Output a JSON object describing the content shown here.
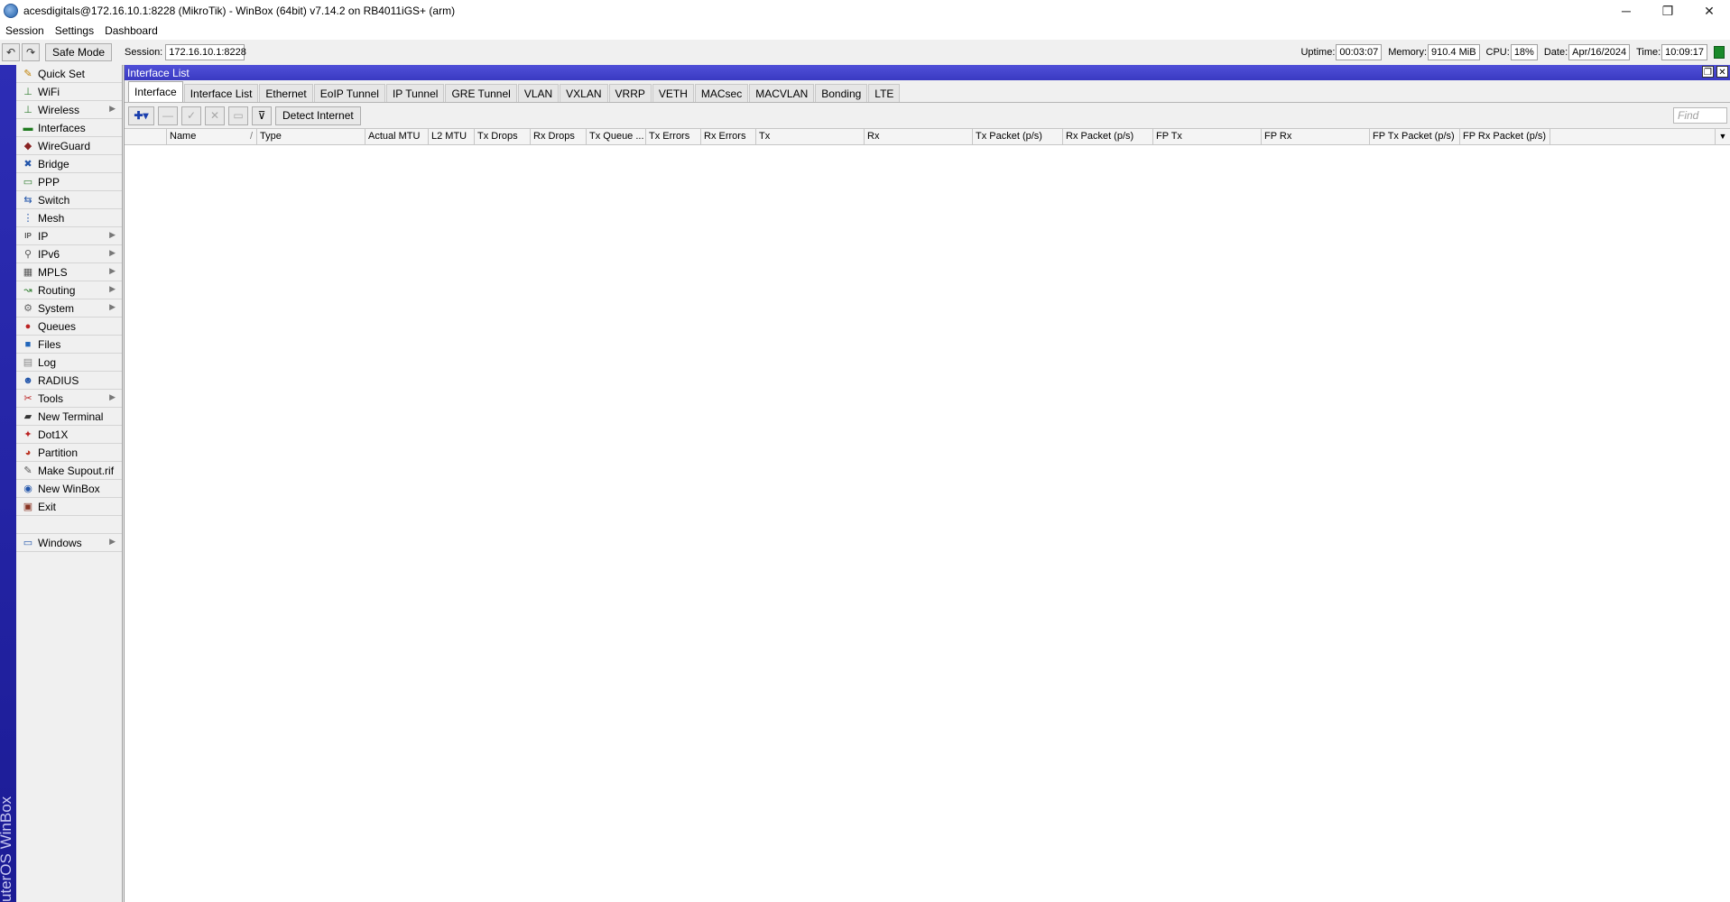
{
  "window": {
    "title": "acesdigitals@172.16.10.1:8228 (MikroTik) - WinBox (64bit) v7.14.2 on RB4011iGS+ (arm)",
    "controls": {
      "minimize": "─",
      "maximize": "❐",
      "close": "✕"
    }
  },
  "menu": [
    "Session",
    "Settings",
    "Dashboard"
  ],
  "toolbar": {
    "undo_icon": "↶",
    "redo_icon": "↷",
    "safe_mode": "Safe Mode",
    "session_label": "Session:",
    "session_value": "172.16.10.1:8228",
    "uptime_label": "Uptime:",
    "uptime_value": "00:03:07",
    "memory_label": "Memory:",
    "memory_value": "910.4 MiB",
    "cpu_label": "CPU:",
    "cpu_value": "18%",
    "date_label": "Date:",
    "date_value": "Apr/16/2024",
    "time_label": "Time:",
    "time_value": "10:09:17"
  },
  "side_strip_text": "uterOS WinBox",
  "sidebar": {
    "items": [
      {
        "label": "Quick Set",
        "icon": "✎",
        "color": "#c08000",
        "arrow": false
      },
      {
        "label": "WiFi",
        "icon": "⊥",
        "color": "#2a7a2a",
        "arrow": false
      },
      {
        "label": "Wireless",
        "icon": "⊥",
        "color": "#2a7a2a",
        "arrow": true
      },
      {
        "label": "Interfaces",
        "icon": "▬",
        "color": "#1f7a1f",
        "arrow": false
      },
      {
        "label": "WireGuard",
        "icon": "◆",
        "color": "#882222",
        "arrow": false
      },
      {
        "label": "Bridge",
        "icon": "✖",
        "color": "#2255aa",
        "arrow": false
      },
      {
        "label": "PPP",
        "icon": "▭",
        "color": "#2a7a2a",
        "arrow": false
      },
      {
        "label": "Switch",
        "icon": "⇆",
        "color": "#2255aa",
        "arrow": false
      },
      {
        "label": "Mesh",
        "icon": "⋮",
        "color": "#2255aa",
        "arrow": false
      },
      {
        "label": "IP",
        "icon": "IP",
        "color": "#555555",
        "arrow": true
      },
      {
        "label": "IPv6",
        "icon": "⚲",
        "color": "#555555",
        "arrow": true
      },
      {
        "label": "MPLS",
        "icon": "▦",
        "color": "#555555",
        "arrow": true
      },
      {
        "label": "Routing",
        "icon": "↝",
        "color": "#2a7a2a",
        "arrow": true
      },
      {
        "label": "System",
        "icon": "⚙",
        "color": "#666666",
        "arrow": true
      },
      {
        "label": "Queues",
        "icon": "●",
        "color": "#bb2222",
        "arrow": false
      },
      {
        "label": "Files",
        "icon": "■",
        "color": "#2266bb",
        "arrow": false
      },
      {
        "label": "Log",
        "icon": "▤",
        "color": "#888888",
        "arrow": false
      },
      {
        "label": "RADIUS",
        "icon": "☻",
        "color": "#2255aa",
        "arrow": false
      },
      {
        "label": "Tools",
        "icon": "✂",
        "color": "#bb2222",
        "arrow": true
      },
      {
        "label": "New Terminal",
        "icon": "▰",
        "color": "#333333",
        "arrow": false
      },
      {
        "label": "Dot1X",
        "icon": "✦",
        "color": "#bb2222",
        "arrow": false
      },
      {
        "label": "Partition",
        "icon": "◕",
        "color": "#bb3322",
        "arrow": false
      },
      {
        "label": "Make Supout.rif",
        "icon": "✎",
        "color": "#555555",
        "arrow": false
      },
      {
        "label": "New WinBox",
        "icon": "◉",
        "color": "#2255aa",
        "arrow": false
      },
      {
        "label": "Exit",
        "icon": "▣",
        "color": "#883322",
        "arrow": false
      }
    ],
    "windows": {
      "label": "Windows",
      "icon": "▭",
      "color": "#2255aa",
      "arrow": true
    }
  },
  "panel": {
    "title": "Interface List",
    "ctrl_restore": "❐",
    "ctrl_close": "✕",
    "tabs": [
      "Interface",
      "Interface List",
      "Ethernet",
      "EoIP Tunnel",
      "IP Tunnel",
      "GRE Tunnel",
      "VLAN",
      "VXLAN",
      "VRRP",
      "VETH",
      "MACsec",
      "MACVLAN",
      "Bonding",
      "LTE"
    ],
    "active_tab": 0,
    "actions": {
      "add_icon": "✚▾",
      "remove_icon": "—",
      "enable_icon": "✓",
      "disable_icon": "✕",
      "comment_icon": "▭",
      "filter_icon": "⊽",
      "detect_internet": "Detect Internet",
      "find_placeholder": "Find"
    },
    "columns": [
      {
        "label": "",
        "w": 47
      },
      {
        "label": "Name",
        "w": 100,
        "sort": "/"
      },
      {
        "label": "Type",
        "w": 120
      },
      {
        "label": "Actual MTU",
        "w": 70
      },
      {
        "label": "L2 MTU",
        "w": 51
      },
      {
        "label": "Tx Drops",
        "w": 62
      },
      {
        "label": "Rx Drops",
        "w": 62
      },
      {
        "label": "Tx Queue ...",
        "w": 66
      },
      {
        "label": "Tx Errors",
        "w": 61
      },
      {
        "label": "Rx Errors",
        "w": 61
      },
      {
        "label": "Tx",
        "w": 120
      },
      {
        "label": "Rx",
        "w": 120
      },
      {
        "label": "Tx Packet (p/s)",
        "w": 100
      },
      {
        "label": "Rx Packet (p/s)",
        "w": 100
      },
      {
        "label": "FP Tx",
        "w": 120
      },
      {
        "label": "FP Rx",
        "w": 120
      },
      {
        "label": "FP Tx Packet (p/s)",
        "w": 100
      },
      {
        "label": "FP Rx Packet (p/s)",
        "w": 100
      }
    ],
    "dropdown_icon": "▼"
  }
}
